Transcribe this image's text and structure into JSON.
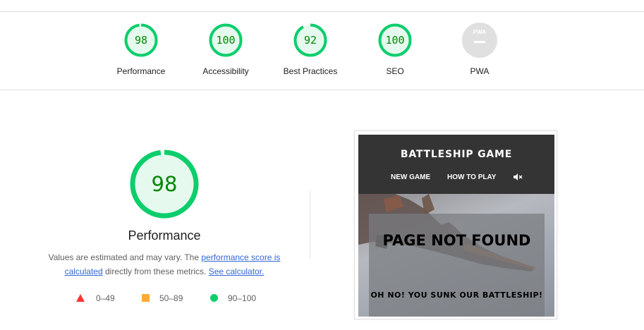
{
  "categories": [
    {
      "label": "Performance",
      "score": "98",
      "value": 98
    },
    {
      "label": "Accessibility",
      "score": "100",
      "value": 100
    },
    {
      "label": "Best Practices",
      "score": "92",
      "value": 92
    },
    {
      "label": "SEO",
      "score": "100",
      "value": 100
    },
    {
      "label": "PWA",
      "score": null,
      "value": null,
      "badge_text": "PWA"
    }
  ],
  "performance": {
    "score": "98",
    "value": 98,
    "title": "Performance",
    "desc_part1": "Values are estimated and may vary. The ",
    "link_score": "performance score is calculated",
    "desc_part2": " directly from these metrics. ",
    "link_calculator": "See calculator."
  },
  "legend": [
    {
      "range": "0–49",
      "shape": "triangle",
      "color": "#ff3333"
    },
    {
      "range": "50–89",
      "shape": "square",
      "color": "#ffaa33"
    },
    {
      "range": "90–100",
      "shape": "circle",
      "color": "#0cce6b"
    }
  ],
  "colors": {
    "pass_ring": "#0cce6b",
    "pass_fill": "#e5f9ee",
    "pass_text": "#008800",
    "link": "#3367d6",
    "pwa_grey": "#e0e0e0"
  },
  "screenshot": {
    "site_title": "BATTLESHIP GAME",
    "nav_links": [
      "NEW GAME",
      "HOW TO PLAY"
    ],
    "mute_icon": "speaker-mute-icon",
    "heading": "PAGE NOT FOUND",
    "subheading": "OH NO! YOU SUNK OUR BATTLESHIP!"
  }
}
